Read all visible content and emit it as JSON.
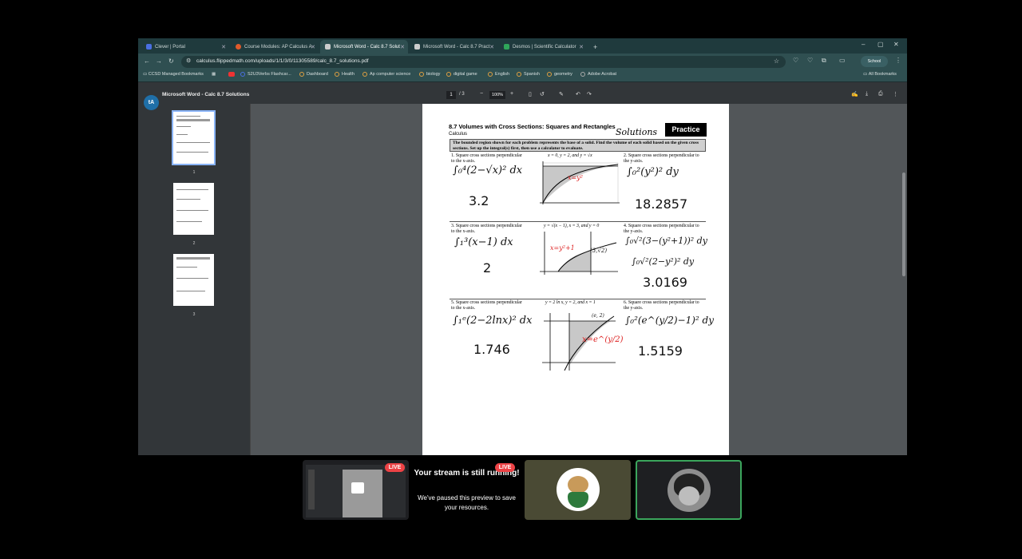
{
  "browser": {
    "tabs": [
      {
        "label": "Clever | Portal",
        "color": "#4a6fe3"
      },
      {
        "label": "Course Modules: AP Calculus A",
        "color": "#e05a2b"
      },
      {
        "label": "Microsoft Word - Calc 8.7 Solut",
        "color": "#cccccc",
        "active": true
      },
      {
        "label": "Microsoft Word - Calc 8.7 Pract",
        "color": "#cccccc"
      },
      {
        "label": "Desmos | Scientific Calculator",
        "color": "#2fa65a"
      }
    ],
    "new_tab": "+",
    "url": "calculus.flippedmath.com/uploads/1/1/3/0/11305589/calc_8.7_solutions.pdf",
    "profile_label": "School",
    "bookmarks": [
      "CCSD Managed Bookmarks",
      "S2U3Verbs Flashcar...",
      "Dashboard",
      "Health",
      "Ap computer science",
      "biology",
      "digital game",
      "English",
      "Spanish",
      "geometry",
      "Adobe Acrobat"
    ],
    "all_bookmarks": "All Bookmarks"
  },
  "pdf": {
    "title": "Microsoft Word - Calc 8.7 Solutions",
    "page_current": "1",
    "page_total": "/ 3",
    "zoom": "100%",
    "thumb_labels": [
      "1",
      "2",
      "3"
    ],
    "avatar_letters": "tA"
  },
  "doc": {
    "title": "8.7 Volumes with Cross Sections: Squares and Rectangles",
    "subtitle": "Calculus",
    "practice": "Practice",
    "solutions": "Solutions",
    "instructions": "The bounded region shown for each problem represents the base of a solid.  Find the volume of each solid based on the given cross sections.  Set up the integral(s) first, then use a calculator to evaluate.",
    "problems": [
      {
        "num": "1.",
        "text": "Square cross sections perpendicular to the x-axis.",
        "region": "x = 0, y = 2, and y = √x",
        "integral": "∫₀⁴(2−√x)² dx",
        "answer": "3.2"
      },
      {
        "num": "2.",
        "text": "Square cross sections perpendicular to the y-axis.",
        "integral": "∫₀²(y²)² dy",
        "answer": "18.2857",
        "note": "x=y²"
      },
      {
        "num": "3.",
        "text": "Square cross sections perpendicular to the x-axis.",
        "region": "y = √(x − 1), x = 3, and y = 0",
        "integral": "∫₁³(x−1) dx",
        "answer": "2",
        "note": "x=y²+1",
        "point": "(3,√2)"
      },
      {
        "num": "4.",
        "text": "Square cross sections perpendicular to the y-axis.",
        "integral": "∫₀√²(3−(y²+1))² dy",
        "integral2": "∫₀√²(2−y²)² dy",
        "answer": "3.0169"
      },
      {
        "num": "5.",
        "text": "Square cross sections perpendicular to the x-axis.",
        "region": "y = 2 ln x, y = 2, and x = 1",
        "integral": "∫₁ᵉ(2−2lnx)² dx",
        "answer": "1.746",
        "point": "(e, 2)",
        "note": "x=e^(y/2)"
      },
      {
        "num": "6.",
        "text": "Square cross sections perpendicular to the y-axis.",
        "integral": "∫₀²(e^(y/2)−1)² dy",
        "answer": "1.5159"
      }
    ]
  },
  "stream": {
    "live_label": "LIVE",
    "paused_title": "Your stream is still running!",
    "paused_sub": "We've paused this preview to save your resources."
  },
  "colors": {
    "tab_bg": "#1f3a3d",
    "toolbar_bg": "#2f4f51",
    "pdf_bg": "#525659",
    "live_red": "#ed4245",
    "speaker_border": "#3ba55c"
  }
}
